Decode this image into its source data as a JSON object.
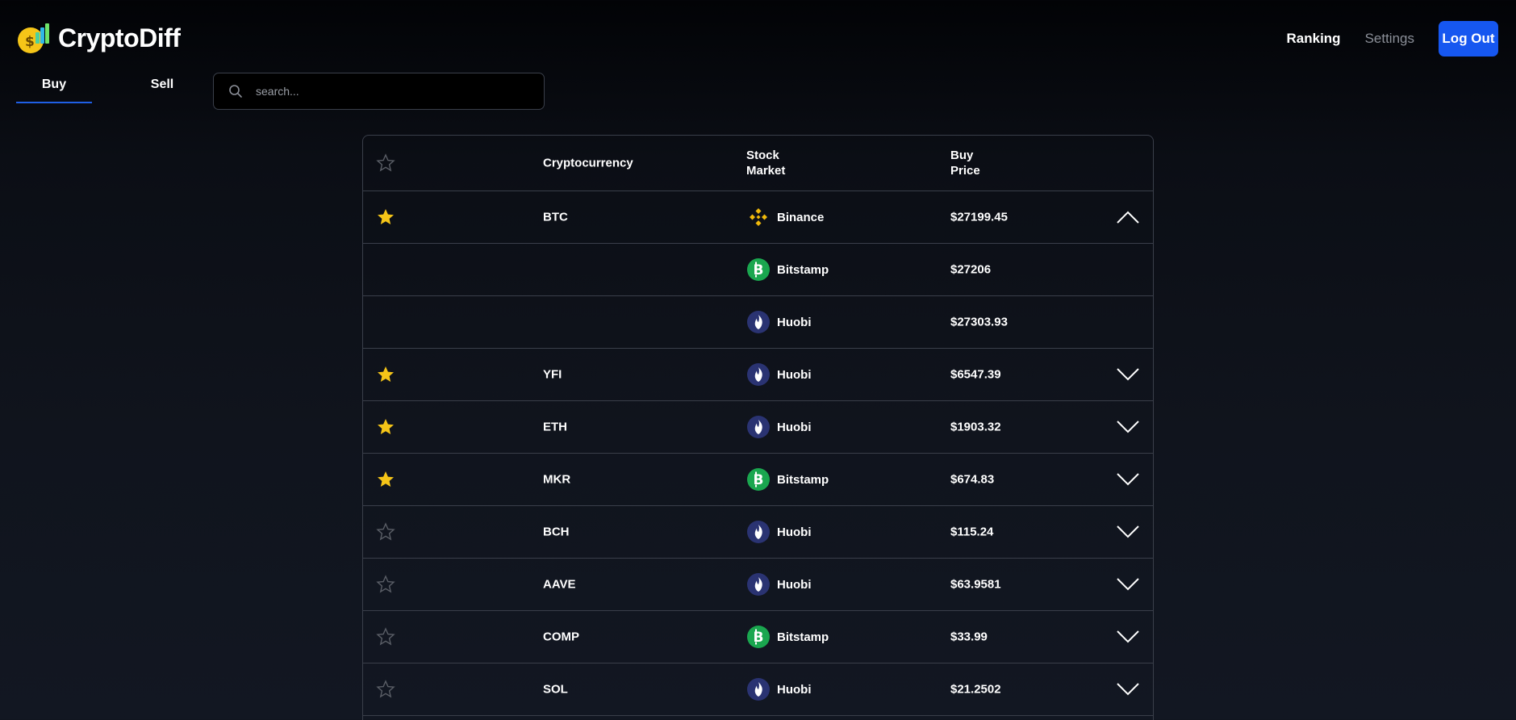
{
  "app": {
    "title": "CryptoDiff",
    "colors": {
      "accent": "#1657f0",
      "star": "#f5c518",
      "binance": "#f0b90b",
      "bitstamp": "#1aa64f",
      "huobi": "#2a3372"
    }
  },
  "nav": {
    "ranking": "Ranking",
    "settings": "Settings",
    "logout": "Log Out"
  },
  "tabs": [
    {
      "label": "Buy",
      "active": true
    },
    {
      "label": "Sell",
      "active": false
    }
  ],
  "search": {
    "placeholder": "search...",
    "value": ""
  },
  "table": {
    "headers": {
      "cryptocurrency": "Cryptocurrency",
      "market_line1": "Stock",
      "market_line2": "Market",
      "price_line1": "Buy",
      "price_line2": "Price"
    },
    "rows": [
      {
        "favorite": true,
        "symbol": "BTC",
        "market": "Binance",
        "market_icon": "binance-icon",
        "price": "$27199.45",
        "expanded": true,
        "sub": false
      },
      {
        "favorite": null,
        "symbol": "",
        "market": "Bitstamp",
        "market_icon": "bitstamp-icon",
        "price": "$27206",
        "expanded": null,
        "sub": true
      },
      {
        "favorite": null,
        "symbol": "",
        "market": "Huobi",
        "market_icon": "huobi-icon",
        "price": "$27303.93",
        "expanded": null,
        "sub": true
      },
      {
        "favorite": true,
        "symbol": "YFI",
        "market": "Huobi",
        "market_icon": "huobi-icon",
        "price": "$6547.39",
        "expanded": false,
        "sub": false
      },
      {
        "favorite": true,
        "symbol": "ETH",
        "market": "Huobi",
        "market_icon": "huobi-icon",
        "price": "$1903.32",
        "expanded": false,
        "sub": false
      },
      {
        "favorite": true,
        "symbol": "MKR",
        "market": "Bitstamp",
        "market_icon": "bitstamp-icon",
        "price": "$674.83",
        "expanded": false,
        "sub": false
      },
      {
        "favorite": false,
        "symbol": "BCH",
        "market": "Huobi",
        "market_icon": "huobi-icon",
        "price": "$115.24",
        "expanded": false,
        "sub": false
      },
      {
        "favorite": false,
        "symbol": "AAVE",
        "market": "Huobi",
        "market_icon": "huobi-icon",
        "price": "$63.9581",
        "expanded": false,
        "sub": false
      },
      {
        "favorite": false,
        "symbol": "COMP",
        "market": "Bitstamp",
        "market_icon": "bitstamp-icon",
        "price": "$33.99",
        "expanded": false,
        "sub": false
      },
      {
        "favorite": false,
        "symbol": "SOL",
        "market": "Huobi",
        "market_icon": "huobi-icon",
        "price": "$21.2502",
        "expanded": false,
        "sub": false
      }
    ]
  }
}
